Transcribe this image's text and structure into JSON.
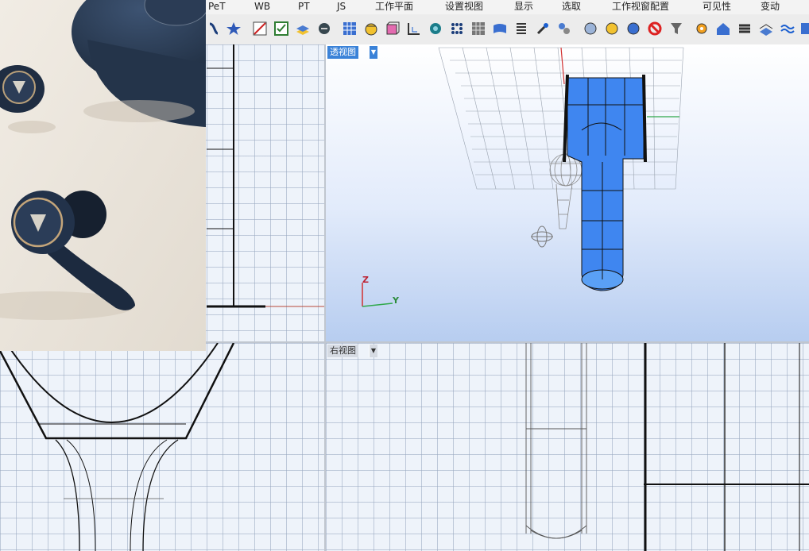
{
  "menu": {
    "items": [
      "PeT",
      "WB",
      "PT",
      "JS",
      "工作平面",
      "设置视图",
      "显示",
      "选取",
      "工作视窗配置",
      "可见性",
      "变动"
    ]
  },
  "toolbar": {
    "icons": [
      "curve-tool-icon",
      "star-icon",
      "polygon-icon",
      "select-box-icon",
      "layer-icon",
      "render-icon",
      "grid-icon",
      "box-icon",
      "cube-icon",
      "axis-icon",
      "object-icon",
      "points-icon",
      "mesh-icon",
      "surface-icon",
      "layers-list-icon",
      "settings-icon",
      "link-icon",
      "sphere-icon",
      "sphere-yellow-icon",
      "sphere-blue-icon",
      "forbid-icon",
      "funnel-icon",
      "gear-icon",
      "home-icon",
      "stack-icon",
      "book-icon",
      "wave-icon",
      "end-icon"
    ]
  },
  "viewports": {
    "top_left": {
      "label": ""
    },
    "perspective": {
      "label": "透视图",
      "axis_z": "Z",
      "axis_y": "Y"
    },
    "bottom_left": {
      "label": ""
    },
    "right": {
      "label": "右视图"
    },
    "bottom_right": {
      "label": ""
    }
  },
  "colors": {
    "active_label": "#3a82d8",
    "model_blue": "#3f86f0",
    "axis_red": "#d23030",
    "axis_green": "#2fa84a"
  }
}
